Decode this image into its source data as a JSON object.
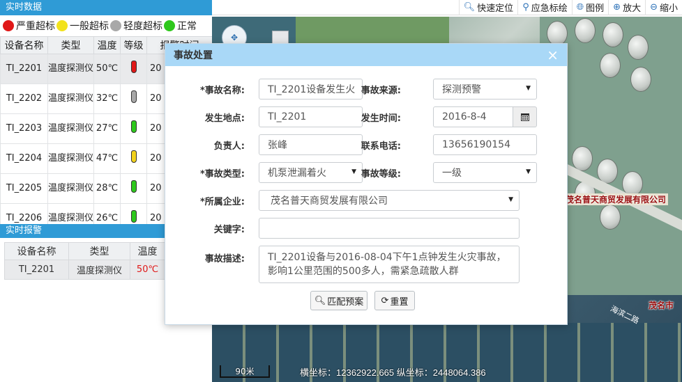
{
  "toolbar": {
    "items": [
      {
        "icon": "search-icon",
        "label": "快速定位"
      },
      {
        "icon": "pin-icon",
        "label": "应急标绘"
      },
      {
        "icon": "globe-icon",
        "label": "图例"
      },
      {
        "icon": "zoom-in-icon",
        "label": "放大"
      },
      {
        "icon": "zoom-out-icon",
        "label": "缩小"
      }
    ]
  },
  "realtime": {
    "title": "实时数据",
    "legend": [
      {
        "label": "严重超标",
        "color": "#e01818"
      },
      {
        "label": "一般超标",
        "color": "#f2e21c"
      },
      {
        "label": "轻度超标",
        "color": "#a8a8a8"
      },
      {
        "label": "正常",
        "color": "#2ec81c"
      }
    ],
    "columns": [
      "设备名称",
      "类型",
      "温度",
      "等级",
      "报警时间"
    ],
    "rows": [
      {
        "name": "TI_2201",
        "type": "温度探测仪",
        "temp": "50℃",
        "level_color": "#e01818",
        "time": "20",
        "hot": true
      },
      {
        "name": "TI_2202",
        "type": "温度探测仪",
        "temp": "32℃",
        "level_color": "#a8a8a8",
        "time": "20",
        "hot": true
      },
      {
        "name": "TI_2203",
        "type": "温度探测仪",
        "temp": "27℃",
        "level_color": "#2ec81c",
        "time": "20",
        "hot": true
      },
      {
        "name": "TI_2204",
        "type": "温度探测仪",
        "temp": "47℃",
        "level_color": "#f2d21c",
        "time": "20",
        "hot": true
      },
      {
        "name": "TI_2205",
        "type": "温度探测仪",
        "temp": "28℃",
        "level_color": "#2ec81c",
        "time": "20",
        "hot": true
      },
      {
        "name": "TI_2206",
        "type": "温度探测仪",
        "temp": "26℃",
        "level_color": "#2ec81c",
        "time": "20",
        "hot": true
      }
    ]
  },
  "alarm": {
    "title": "实时报警",
    "columns": [
      "设备名称",
      "类型",
      "温度"
    ],
    "rows": [
      {
        "name": "TI_2201",
        "type": "温度探测仪",
        "temp": "50℃"
      }
    ]
  },
  "map": {
    "labels": [
      "茂名普天商贸发展有限公司",
      "茂名市"
    ],
    "road_label": "海滨二路",
    "scale": "90米",
    "coords": "横坐标：12362922.665 纵坐标：2448064.386"
  },
  "dialog": {
    "title": "事故处置",
    "fields": {
      "name": {
        "label": "*事故名称:",
        "value": "TI_2201设备发生火"
      },
      "source": {
        "label": "事故来源:",
        "value": "探测预警"
      },
      "place": {
        "label": "发生地点:",
        "value": "TI_2201"
      },
      "time": {
        "label": "发生时间:",
        "value": "2016-8-4"
      },
      "owner": {
        "label": "负责人:",
        "value": "张峰"
      },
      "phone": {
        "label": "联系电话:",
        "value": "13656190154"
      },
      "type": {
        "label": "*事故类型:",
        "value": "机泵泄漏着火"
      },
      "level": {
        "label": "事故等级:",
        "value": "一级"
      },
      "company": {
        "label": "*所属企业:",
        "value": "茂名普天商贸发展有限公司"
      },
      "keyword": {
        "label": "关键字:",
        "value": ""
      },
      "desc": {
        "label": "事故描述:",
        "value": "TI_2201设备与2016-08-04下午1点钟发生火灾事故，影响1公里范围的500多人，需紧急疏散人群"
      }
    },
    "buttons": {
      "match": "匹配预案",
      "reset": "重置"
    }
  }
}
